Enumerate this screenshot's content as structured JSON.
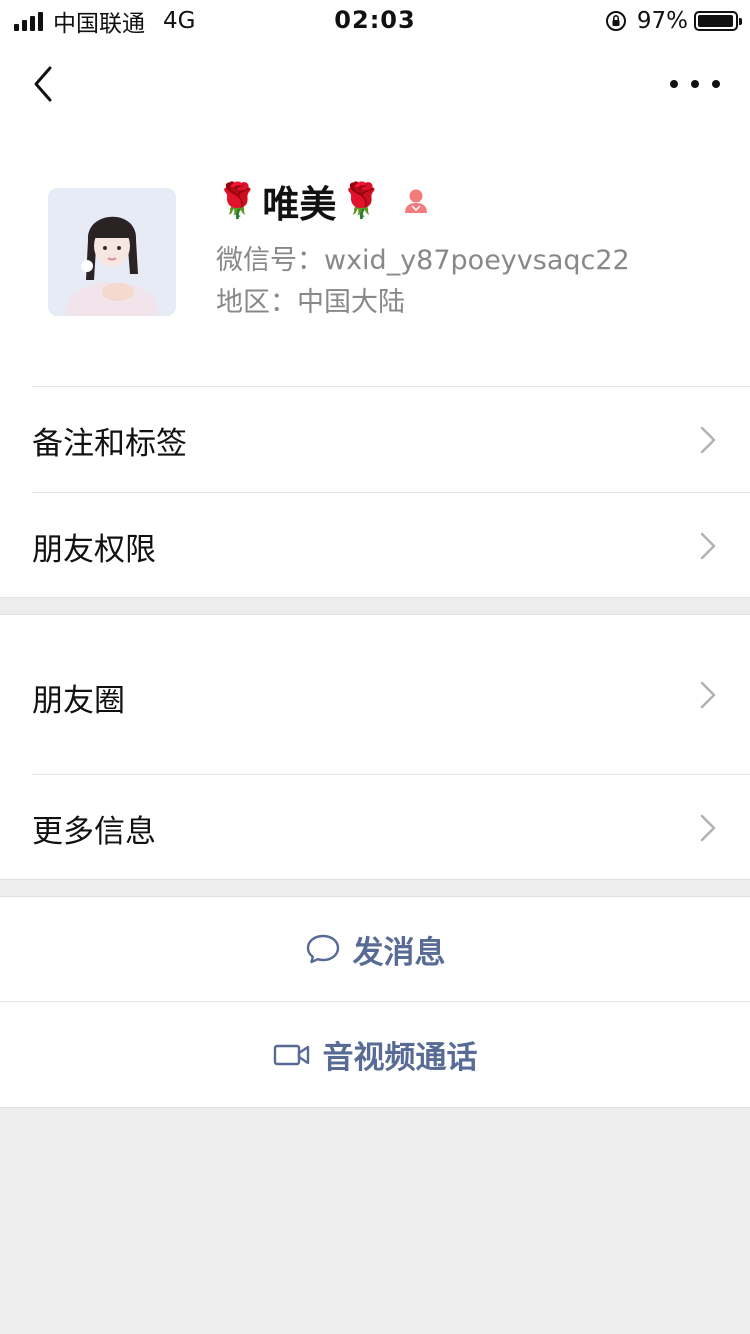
{
  "status_bar": {
    "carrier": "中国联通",
    "network": "4G",
    "time": "02:03",
    "battery": "97%",
    "battery_level": 0.97
  },
  "nav": {
    "back_icon": "chevron-left-icon",
    "more_icon": "more-dots-icon"
  },
  "profile": {
    "name_prefix": "🌹",
    "name": "唯美",
    "name_suffix": "🌹",
    "gender": "female",
    "wechat_id": "微信号：wxid_y87poeyvsaqc22",
    "region": "地区：中国大陆"
  },
  "menu": {
    "remark_tags": "备注和标签",
    "friend_permissions": "朋友权限",
    "moments": "朋友圈",
    "more_info": "更多信息"
  },
  "actions": {
    "send_message": "发消息",
    "video_call": "音视频通话"
  },
  "colors": {
    "link_blue": "#576b95",
    "background_gray": "#ededed",
    "female_icon": "#f27b7b"
  }
}
